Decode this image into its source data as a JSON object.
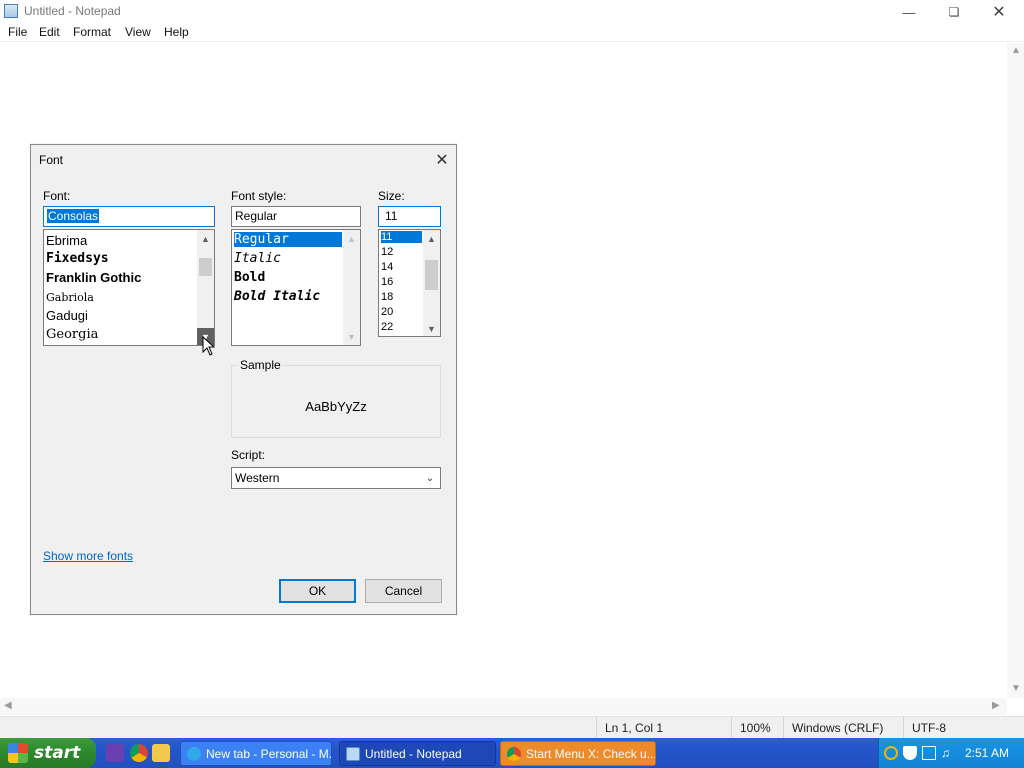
{
  "window": {
    "title": "Untitled - Notepad",
    "menu": [
      "File",
      "Edit",
      "Format",
      "View",
      "Help"
    ]
  },
  "status": {
    "position": "Ln 1, Col 1",
    "zoom": "100%",
    "line_ending": "Windows (CRLF)",
    "encoding": "UTF-8"
  },
  "dialog": {
    "title": "Font",
    "font_label": "Font:",
    "font_value": "Consolas",
    "font_list": [
      "Ebrima",
      "Fixedsys",
      "Franklin Gothic",
      "Gabriola",
      "Gadugi",
      "Georgia"
    ],
    "style_label": "Font style:",
    "style_value": "Regular",
    "style_list": [
      "Regular",
      "Italic",
      "Bold",
      "Bold Italic"
    ],
    "style_selected": "Regular",
    "size_label": "Size:",
    "size_value": "11",
    "size_list": [
      "11",
      "12",
      "14",
      "16",
      "18",
      "20",
      "22"
    ],
    "size_selected": "11",
    "sample_label": "Sample",
    "sample_text": "AaBbYyZz",
    "script_label": "Script:",
    "script_value": "Western",
    "show_more": "Show more fonts",
    "ok": "OK",
    "cancel": "Cancel"
  },
  "taskbar": {
    "start": "start",
    "tasks": [
      {
        "label": "New tab - Personal - M..."
      },
      {
        "label": "Untitled - Notepad"
      },
      {
        "label": "Start Menu X: Check u..."
      }
    ],
    "clock": "2:51 AM"
  },
  "icons": {
    "minimize": "minimize-icon",
    "maximize": "restore-icon",
    "close": "close-icon",
    "dropdown": "chevron-down-icon"
  }
}
